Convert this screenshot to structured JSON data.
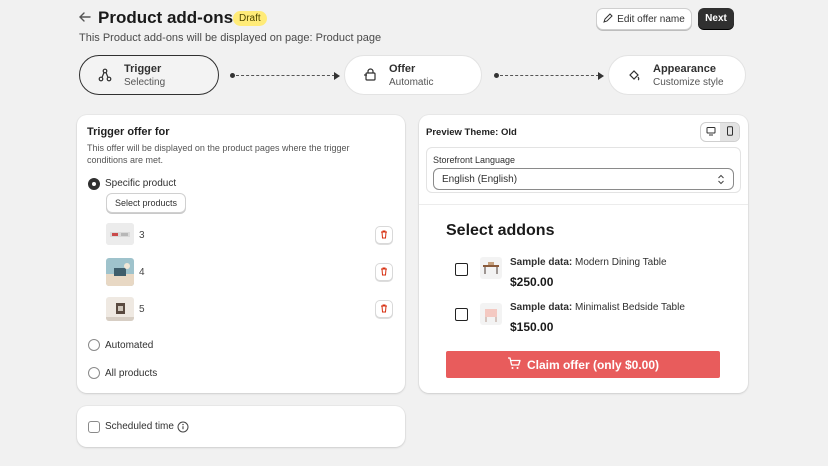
{
  "header": {
    "back_icon": "arrow-left-icon",
    "title": "Product add-ons 1",
    "badge": "Draft",
    "subtitle": "This Product add-ons will be displayed on page: Product page",
    "edit_label": "Edit offer name",
    "next_label": "Next"
  },
  "steps": [
    {
      "name": "Trigger",
      "state": "Selecting",
      "icon": "trigger-icon"
    },
    {
      "name": "Offer",
      "state": "Automatic",
      "icon": "offer-icon"
    },
    {
      "name": "Appearance",
      "state": "Customize style",
      "icon": "paint-icon"
    }
  ],
  "trigger": {
    "title": "Trigger offer for",
    "description": "This offer will be displayed on the product pages where the trigger conditions are met.",
    "options": {
      "specific": "Specific product",
      "automated": "Automated",
      "all": "All products"
    },
    "selected": "specific",
    "select_button": "Select products",
    "products": [
      {
        "label": "3"
      },
      {
        "label": "4"
      },
      {
        "label": "5"
      }
    ]
  },
  "schedule": {
    "label": "Scheduled time"
  },
  "preview": {
    "theme_label": "Preview Theme: Old",
    "language_label": "Storefront Language",
    "language_value": "English (English)",
    "addons_title": "Select addons",
    "items": [
      {
        "prefix": "Sample data:",
        "name": "Modern Dining Table",
        "price": "$250.00"
      },
      {
        "prefix": "Sample data:",
        "name": "Minimalist Bedside Table",
        "price": "$150.00"
      }
    ],
    "claim_label": "Claim offer (only $0.00)",
    "claim_color": "#e85c5c"
  }
}
